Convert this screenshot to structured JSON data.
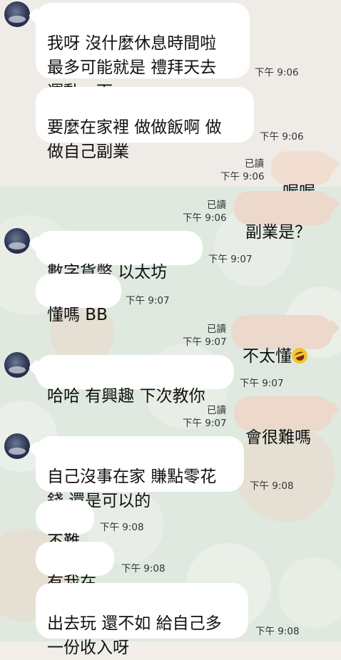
{
  "messages": [
    {
      "text": "我呀 沒什麼休息時間啦\n最多可能就是 禮拜天去\n運動一下",
      "time": "下午 9:06"
    },
    {
      "text": "要麼在家裡 做做飯啊 做\n做自己副業",
      "time": "下午 9:06"
    },
    {
      "text": "喔喔",
      "time": "下午 9:06",
      "read": "已讀"
    },
    {
      "text": "副業是？",
      "time": "下午 9:06",
      "read": "已讀"
    },
    {
      "text": "數字貨幣 以太坊",
      "time": "下午 9:07"
    },
    {
      "text": "懂嗎 BB",
      "time": "下午 9:07"
    },
    {
      "text": "不太懂",
      "emoji": "rolling-laughing-emoji",
      "time": "下午 9:07",
      "read": "已讀"
    },
    {
      "text": "哈哈 有興趣 下次教你",
      "time": "下午 9:07"
    },
    {
      "text": "會很難嗎",
      "time": "下午 9:07",
      "read": "已讀"
    },
    {
      "text": "自己沒事在家 賺點零花\n錢 還是可以的",
      "time": "下午 9:08"
    },
    {
      "text": "不難",
      "time": "下午 9:08"
    },
    {
      "text": "有我在",
      "time": "下午 9:08"
    },
    {
      "text": "出去玩 還不如 給自己多\n一份收入呀",
      "time": "下午 9:08"
    }
  ],
  "colors": {
    "incoming": "#ffffff",
    "outgoing": "#ecd9cc",
    "background_top": "#efece8",
    "background_pattern": "#dfe9df"
  }
}
